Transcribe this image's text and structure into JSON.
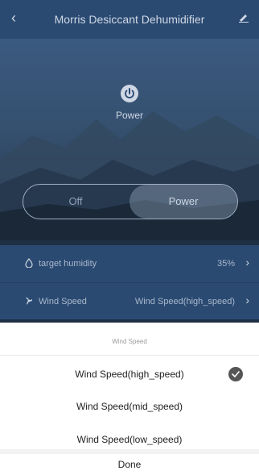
{
  "header": {
    "title": "Morris Desiccant Dehumidifier",
    "back_icon": "chevron-left-icon",
    "edit_icon": "pencil-icon"
  },
  "power": {
    "label": "Power",
    "icon": "power-icon"
  },
  "toggle": {
    "off_label": "Off",
    "on_label": "Power",
    "selected": "Power"
  },
  "settings": [
    {
      "icon": "water-drop-icon",
      "label": "target humidity",
      "value": "35%"
    },
    {
      "icon": "fan-icon",
      "label": "Wind Speed",
      "value": "Wind Speed(high_speed)"
    }
  ],
  "sheet": {
    "title": "Wind Speed",
    "options": [
      {
        "label": "Wind Speed(high_speed)",
        "selected": true
      },
      {
        "label": "Wind Speed(mid_speed)",
        "selected": false
      },
      {
        "label": "Wind Speed(low_speed)",
        "selected": false
      }
    ],
    "done_label": "Done"
  },
  "colors": {
    "header_bg": "#2b4a72",
    "sheet_bg": "#ffffff",
    "check_bg": "#555555"
  }
}
